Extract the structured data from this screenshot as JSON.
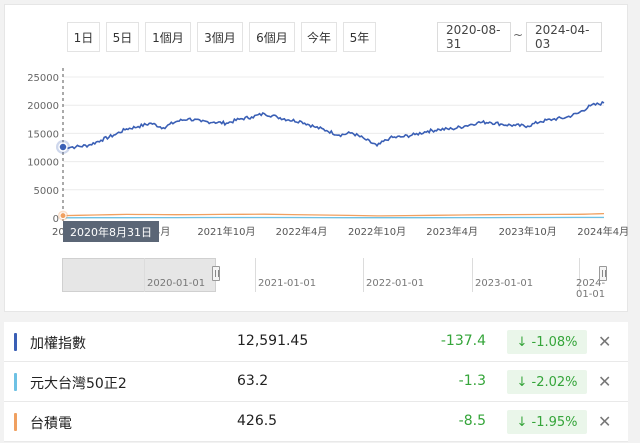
{
  "range_buttons": [
    "1日",
    "5日",
    "1個月",
    "3個月",
    "6個月",
    "今年",
    "5年"
  ],
  "date_range": {
    "start": "2020-08-31",
    "separator": "~",
    "end": "2024-04-03"
  },
  "tooltip_date": "2020年8月31日",
  "colors": {
    "taiex": "#3a5fb5",
    "etf50": "#6ec1e4",
    "tsmc": "#f0a060",
    "down": "#35a53a"
  },
  "chart_data": {
    "type": "line",
    "title": "",
    "ylim": [
      0,
      25000
    ],
    "y_ticks": [
      "25000",
      "20000",
      "15000",
      "10000",
      "5000",
      "0"
    ],
    "x_tick_labels": [
      "20",
      "21年4月",
      "2021年10月",
      "2022年4月",
      "2022年10月",
      "2023年4月",
      "2023年10月",
      "2024年4月"
    ],
    "series": [
      {
        "name": "加權指數",
        "color": "#3a5fb5",
        "points": [
          [
            "2020-08-31",
            12591
          ],
          [
            "2020-10-01",
            12600
          ],
          [
            "2020-11-01",
            12900
          ],
          [
            "2020-12-01",
            13800
          ],
          [
            "2021-01-01",
            14700
          ],
          [
            "2021-02-01",
            15800
          ],
          [
            "2021-03-01",
            16200
          ],
          [
            "2021-04-01",
            16800
          ],
          [
            "2021-05-01",
            16000
          ],
          [
            "2021-06-01",
            17100
          ],
          [
            "2021-07-01",
            17600
          ],
          [
            "2021-08-01",
            17100
          ],
          [
            "2021-09-01",
            17000
          ],
          [
            "2021-10-01",
            16800
          ],
          [
            "2021-11-01",
            17500
          ],
          [
            "2021-12-01",
            17900
          ],
          [
            "2022-01-01",
            18500
          ],
          [
            "2022-02-01",
            17900
          ],
          [
            "2022-03-01",
            17400
          ],
          [
            "2022-04-01",
            17100
          ],
          [
            "2022-05-01",
            16200
          ],
          [
            "2022-06-01",
            15500
          ],
          [
            "2022-07-01",
            14700
          ],
          [
            "2022-08-01",
            15100
          ],
          [
            "2022-09-01",
            14000
          ],
          [
            "2022-10-01",
            12800
          ],
          [
            "2022-11-01",
            14200
          ],
          [
            "2022-12-01",
            14400
          ],
          [
            "2023-01-01",
            14800
          ],
          [
            "2023-02-01",
            15400
          ],
          [
            "2023-03-01",
            15700
          ],
          [
            "2023-04-01",
            15800
          ],
          [
            "2023-05-01",
            16300
          ],
          [
            "2023-06-01",
            16900
          ],
          [
            "2023-07-01",
            17000
          ],
          [
            "2023-08-01",
            16600
          ],
          [
            "2023-09-01",
            16400
          ],
          [
            "2023-10-01",
            16300
          ],
          [
            "2023-11-01",
            17100
          ],
          [
            "2023-12-01",
            17500
          ],
          [
            "2024-01-01",
            17800
          ],
          [
            "2024-02-01",
            18600
          ],
          [
            "2024-03-01",
            19900
          ],
          [
            "2024-04-03",
            20400
          ]
        ]
      },
      {
        "name": "元大台灣50正2",
        "color": "#6ec1e4",
        "points": [
          [
            "2020-08-31",
            40
          ],
          [
            "2021-06-01",
            75
          ],
          [
            "2022-01-01",
            95
          ],
          [
            "2022-10-01",
            45
          ],
          [
            "2023-07-01",
            70
          ],
          [
            "2024-04-03",
            110
          ]
        ]
      },
      {
        "name": "台積電",
        "color": "#f0a060",
        "points": [
          [
            "2020-08-31",
            426
          ],
          [
            "2021-02-01",
            640
          ],
          [
            "2021-06-01",
            590
          ],
          [
            "2022-01-01",
            670
          ],
          [
            "2022-10-01",
            380
          ],
          [
            "2023-07-01",
            580
          ],
          [
            "2024-02-01",
            650
          ],
          [
            "2024-04-03",
            780
          ]
        ]
      }
    ]
  },
  "navigator_ticks": [
    "2020-01-01",
    "2021-01-01",
    "2022-01-01",
    "2023-01-01",
    "2024-01-01"
  ],
  "rows": [
    {
      "name": "加權指數",
      "price": "12,591.45",
      "change": "-137.4",
      "percent": "↓ -1.08%",
      "color": "#3a5fb5",
      "close": "✕"
    },
    {
      "name": "元大台灣50正2",
      "price": "63.2",
      "change": "-1.3",
      "percent": "↓ -2.02%",
      "color": "#6ec1e4",
      "close": "✕"
    },
    {
      "name": "台積電",
      "price": "426.5",
      "change": "-8.5",
      "percent": "↓ -1.95%",
      "color": "#f0a060",
      "close": "✕"
    }
  ]
}
